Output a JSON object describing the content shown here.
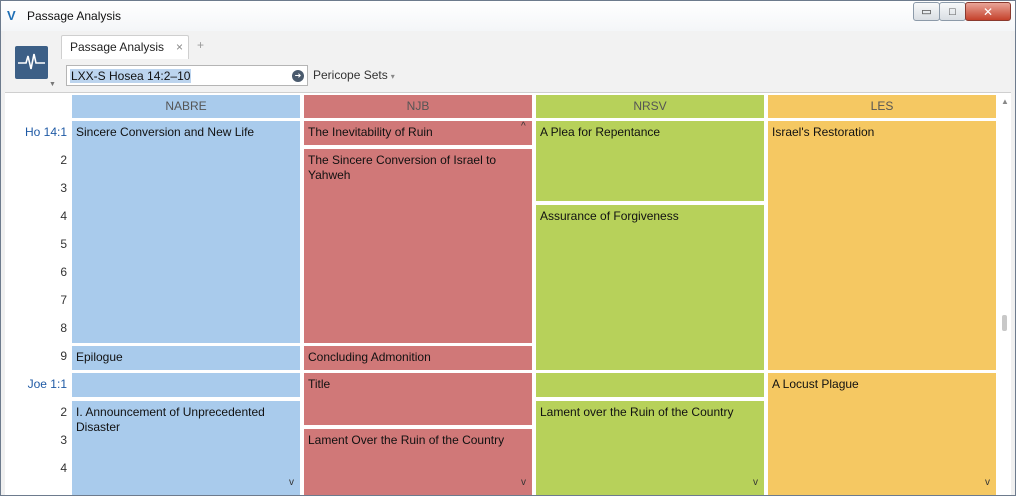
{
  "window": {
    "title": "Passage Analysis",
    "app_icon": "v-icon"
  },
  "window_buttons": {
    "minimize": "▭",
    "maximize": "□",
    "close": "✕"
  },
  "tab": {
    "label": "Passage Analysis",
    "close": "×",
    "new": "+"
  },
  "reference": {
    "value": "LXX-S Hosea 14:2–10"
  },
  "pericope": {
    "label": "Pericope Sets",
    "caret": "▾"
  },
  "columns": [
    {
      "name": "NABRE",
      "color": "#a9cbec"
    },
    {
      "name": "NJB",
      "color": "#d07878"
    },
    {
      "name": "NRSV",
      "color": "#b7d15a"
    },
    {
      "name": "LES",
      "color": "#f5c862"
    }
  ],
  "verses": [
    "Ho 14:1",
    "2",
    "3",
    "4",
    "5",
    "6",
    "7",
    "8",
    "9",
    "Joe 1:1",
    "2",
    "3",
    "4"
  ],
  "sections": {
    "nabre": [
      "Sincere Conversion and New Life",
      "Epilogue",
      "",
      "I. Announcement of Unprecedented Disaster"
    ],
    "njb": [
      "The Inevitability of Ruin",
      "The Sincere Conversion of Israel to Yahweh",
      "Concluding Admonition",
      "Title",
      "Lament Over the Ruin of the Country"
    ],
    "nrsv": [
      "A Plea for Repentance",
      "Assurance of Forgiveness",
      "",
      "Lament over the Ruin of the Country"
    ],
    "les": [
      "Israel's Restoration",
      "A Locust Plague"
    ]
  },
  "arrows": {
    "up": "^",
    "down": "v"
  }
}
